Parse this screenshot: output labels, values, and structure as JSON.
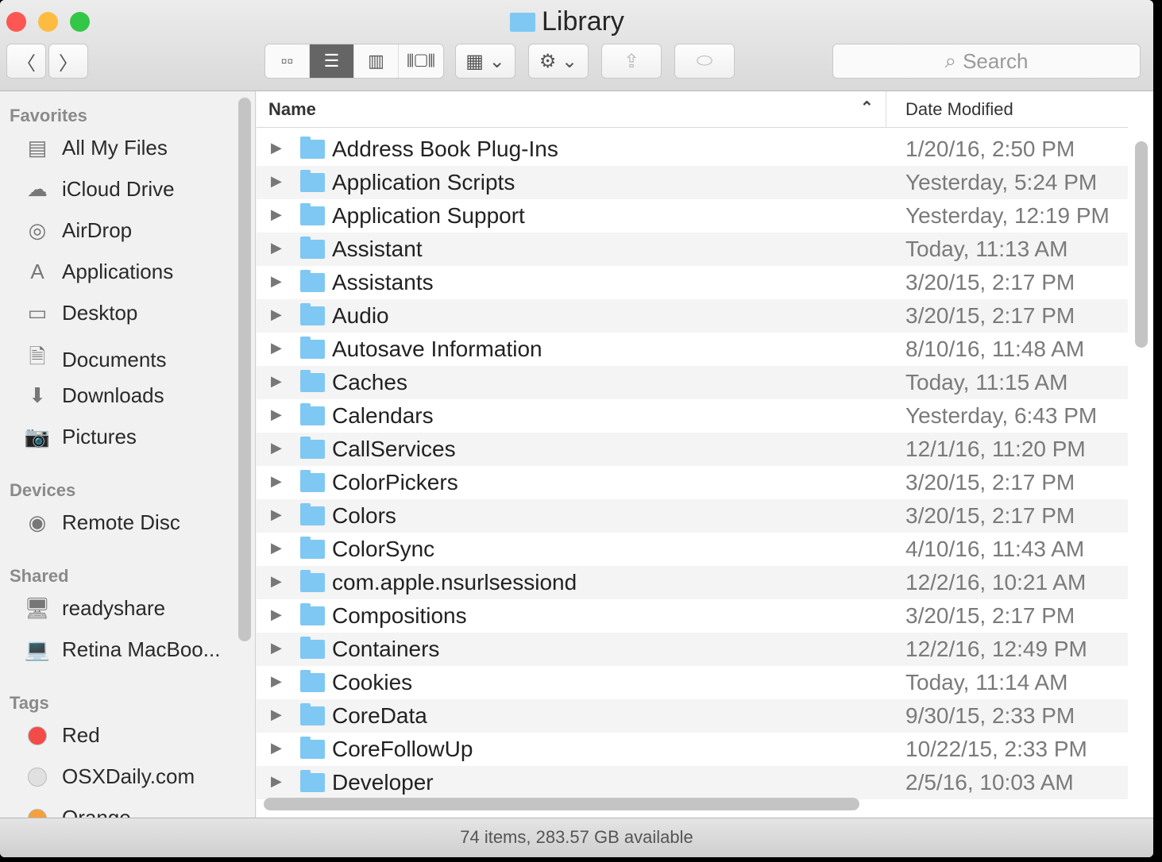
{
  "window": {
    "title": "Library"
  },
  "toolbar": {
    "back": "〈",
    "forward": "〉",
    "views": [
      "icon",
      "list",
      "column",
      "coverflow"
    ],
    "arrange": "arrange",
    "action": "action",
    "share": "share",
    "tag": "tag",
    "search_placeholder": "Search"
  },
  "sidebar": {
    "favorites_label": "Favorites",
    "favorites": [
      {
        "label": "All My Files",
        "icon": "all-files-icon",
        "glyph": "▤"
      },
      {
        "label": "iCloud Drive",
        "icon": "cloud-icon",
        "glyph": "☁"
      },
      {
        "label": "AirDrop",
        "icon": "airdrop-icon",
        "glyph": "◎"
      },
      {
        "label": "Applications",
        "icon": "applications-icon",
        "glyph": "A"
      },
      {
        "label": "Desktop",
        "icon": "desktop-icon",
        "glyph": "▭"
      },
      {
        "label": "Documents",
        "icon": "document-icon",
        "glyph": "🗎"
      },
      {
        "label": "Downloads",
        "icon": "download-icon",
        "glyph": "⬇"
      },
      {
        "label": "Pictures",
        "icon": "camera-icon",
        "glyph": "📷"
      }
    ],
    "devices_label": "Devices",
    "devices": [
      {
        "label": "Remote Disc",
        "icon": "disc-icon",
        "glyph": "◉"
      }
    ],
    "shared_label": "Shared",
    "shared": [
      {
        "label": "readyshare",
        "icon": "server-icon",
        "glyph": "🖥"
      },
      {
        "label": "Retina MacBoo...",
        "icon": "laptop-icon",
        "glyph": "💻"
      }
    ],
    "tags_label": "Tags",
    "tags": [
      {
        "label": "Red",
        "color": "#f24b48"
      },
      {
        "label": "OSXDaily.com",
        "color": "#e0e0e0"
      },
      {
        "label": "Orange",
        "color": "#f5a03c"
      }
    ]
  },
  "columns": {
    "name": "Name",
    "date": "Date Modified"
  },
  "files": [
    {
      "name": "Address Book Plug-Ins",
      "date": "1/20/16, 2:50 PM"
    },
    {
      "name": "Application Scripts",
      "date": "Yesterday, 5:24 PM"
    },
    {
      "name": "Application Support",
      "date": "Yesterday, 12:19 PM"
    },
    {
      "name": "Assistant",
      "date": "Today, 11:13 AM"
    },
    {
      "name": "Assistants",
      "date": "3/20/15, 2:17 PM"
    },
    {
      "name": "Audio",
      "date": "3/20/15, 2:17 PM"
    },
    {
      "name": "Autosave Information",
      "date": "8/10/16, 11:48 AM"
    },
    {
      "name": "Caches",
      "date": "Today, 11:15 AM"
    },
    {
      "name": "Calendars",
      "date": "Yesterday, 6:43 PM"
    },
    {
      "name": "CallServices",
      "date": "12/1/16, 11:20 PM"
    },
    {
      "name": "ColorPickers",
      "date": "3/20/15, 2:17 PM"
    },
    {
      "name": "Colors",
      "date": "3/20/15, 2:17 PM"
    },
    {
      "name": "ColorSync",
      "date": "4/10/16, 11:43 AM"
    },
    {
      "name": "com.apple.nsurlsessiond",
      "date": "12/2/16, 10:21 AM"
    },
    {
      "name": "Compositions",
      "date": "3/20/15, 2:17 PM"
    },
    {
      "name": "Containers",
      "date": "12/2/16, 12:49 PM"
    },
    {
      "name": "Cookies",
      "date": "Today, 11:14 AM"
    },
    {
      "name": "CoreData",
      "date": "9/30/15, 2:33 PM"
    },
    {
      "name": "CoreFollowUp",
      "date": "10/22/15, 2:33 PM"
    },
    {
      "name": "Developer",
      "date": "2/5/16, 10:03 AM"
    }
  ],
  "status": "74 items, 283.57 GB available"
}
